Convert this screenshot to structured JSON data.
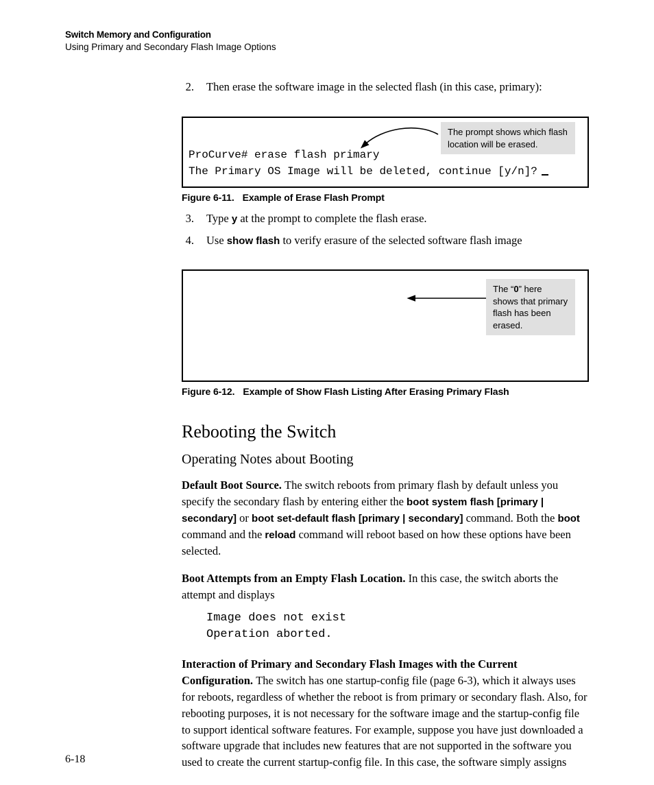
{
  "running_head": {
    "title": "Switch Memory and Configuration",
    "subtitle": "Using Primary and Secondary Flash Image Options"
  },
  "list_top": {
    "num": "2.",
    "text": "Then erase the software image in the selected flash (in this case, primary):"
  },
  "fig11": {
    "callout": "The prompt shows which flash location will be erased.",
    "line1": "ProCurve# erase flash primary",
    "line2": "The Primary OS Image will be deleted, continue [y/n]?",
    "caption_no": "Figure 6-11.",
    "caption_txt": "Example of Erase Flash Prompt"
  },
  "list_mid": [
    {
      "num": "3.",
      "pre": "Type ",
      "bold": "y",
      "post": " at the prompt to complete the flash erase."
    },
    {
      "num": "4.",
      "pre": "Use ",
      "bold": "show flash",
      "post": " to verify erasure of the selected software flash image"
    }
  ],
  "fig12": {
    "callout_pre": "The “",
    "callout_bold": "0",
    "callout_post": "” here shows that primary flash has been erased.",
    "caption_no": "Figure 6-12.",
    "caption_txt": "Example of Show Flash Listing After Erasing Primary Flash"
  },
  "h2": "Rebooting the Switch",
  "h3": "Operating Notes about Booting",
  "p1": {
    "runin": "Default Boot Source.  ",
    "a": "The switch reboots from primary flash by default unless you specify the secondary flash by entering either the ",
    "b1": "boot system flash [primary | secondary]",
    "mid": " or ",
    "b2": "boot set-default flash [primary | secondary]",
    "c": " command. Both the ",
    "b3": "boot",
    "d": " command and the ",
    "b4": "reload",
    "e": " command will reboot based on how these options have been selected."
  },
  "p2": {
    "runin": "Boot Attempts from an Empty Flash Location.  ",
    "text": "In this case, the switch aborts the attempt and displays"
  },
  "code": "Image does not exist\nOperation aborted.",
  "p3": {
    "runin": "Interaction of Primary and Secondary Flash Images with the Current Configuration.  ",
    "text": "The switch has one startup-config file (page 6-3), which it always uses for reboots, regardless of whether the reboot is from primary or secondary flash. Also, for rebooting purposes, it is not necessary for the software image and the startup-config file to support identical software fea­tures. For example, suppose you have just downloaded a software upgrade that includes new features that are not supported in the software you used to create the current startup-config file. In this case, the software simply assigns"
  },
  "page_no": "6-18"
}
